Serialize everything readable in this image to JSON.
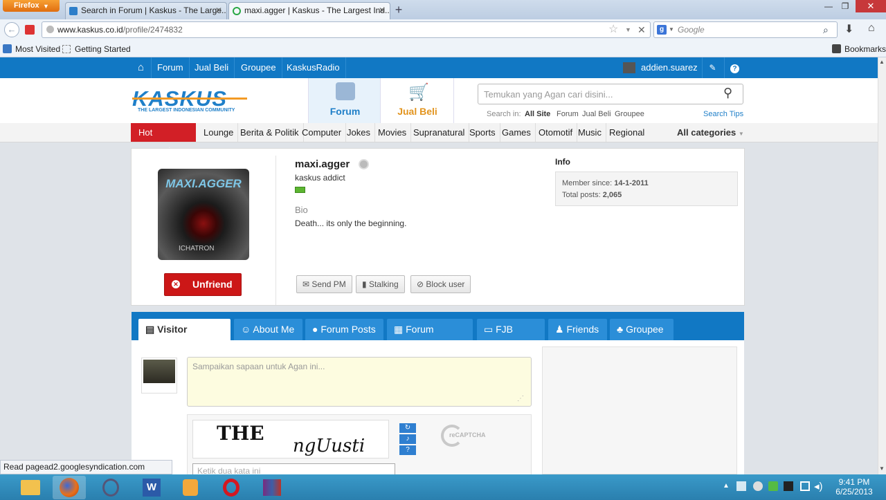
{
  "browser": {
    "menu_label": "Firefox",
    "tabs": [
      {
        "title": "Search in Forum | Kaskus - The Large..."
      },
      {
        "title": "maxi.agger | Kaskus - The Largest Ind..."
      }
    ],
    "url_host": "www.kaskus.co.id",
    "url_path": "/profile/2474832",
    "search_placeholder": "Google",
    "bookmarks": [
      "Most Visited",
      "Getting Started"
    ],
    "bookmarks_menu": "Bookmarks",
    "status_text": "Read pagead2.googlesyndication.com"
  },
  "topnav": {
    "items": [
      "Forum",
      "Jual Beli",
      "Groupee",
      "KaskusRadio"
    ],
    "username": "addien.suarez"
  },
  "header": {
    "logo_text": "KASKUS",
    "logo_tagline": "THE LARGEST INDONESIAN COMMUNITY",
    "tab_forum": "Forum",
    "tab_jualbeli": "Jual Beli",
    "search_placeholder": "Temukan yang Agan cari disini...",
    "search_in_label": "Search in:",
    "search_scopes": [
      "All Site",
      "Forum",
      "Jual Beli",
      "Groupee"
    ],
    "search_tips": "Search Tips"
  },
  "categories": {
    "hot_label": "Hot categories",
    "items": [
      "Lounge",
      "Berita & Politik",
      "Computer",
      "Jokes",
      "Movies",
      "Supranatural",
      "Sports",
      "Games",
      "Otomotif",
      "Music",
      "Regional"
    ],
    "all_label": "All categories"
  },
  "profile": {
    "avatar_text": "MAXI.AGGER",
    "avatar_sub": "ICHATRON",
    "unfriend_label": "Unfriend",
    "username": "maxi.agger",
    "rank": "kaskus addict",
    "bio_label": "Bio",
    "bio_text": "Death... its only the beginning.",
    "info_label": "Info",
    "member_since_label": "Member since:",
    "member_since": "14-1-2011",
    "total_posts_label": "Total posts:",
    "total_posts": "2,065",
    "send_pm": "Send PM",
    "stalking": "Stalking",
    "block_user": "Block user"
  },
  "profile_tabs": [
    "Visitor Message",
    "About Me",
    "Forum Posts",
    "Forum Thread",
    "FJB Store",
    "Friends",
    "Groupee"
  ],
  "visitor": {
    "message_placeholder": "Sampaikan sapaan untuk Agan ini...",
    "captcha_word1": "THE",
    "captcha_word2": "ngUusti",
    "captcha_brand": "reCAPTCHA",
    "captcha_input_placeholder": "Ketik dua kata ini"
  },
  "taskbar": {
    "time": "9:41 PM",
    "date": "6/25/2013"
  },
  "colors": {
    "kaskus_blue": "#1178c4",
    "hot_red": "#d21f26",
    "unfriend_red": "#cc1717"
  }
}
